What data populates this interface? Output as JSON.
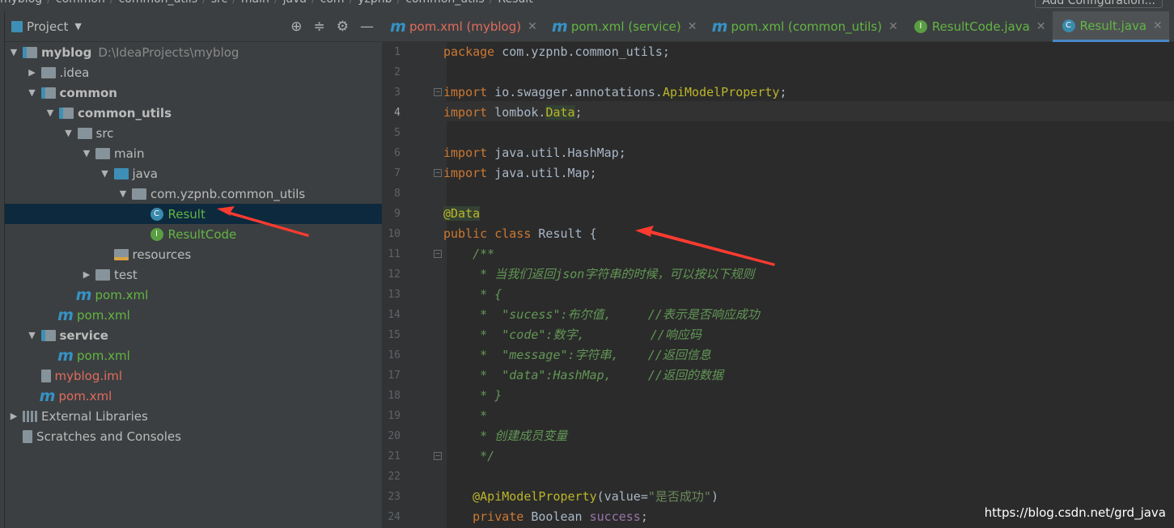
{
  "breadcrumb": [
    "myblog",
    "common",
    "common_utils",
    "src",
    "main",
    "java",
    "com",
    "yzpnb",
    "common_utils",
    "Result"
  ],
  "run_config": "Add Configuration...",
  "project_panel": {
    "title": "Project",
    "tree": [
      {
        "label": "myblog",
        "path": "D:\\IdeaProjects\\myblog",
        "depth": 0,
        "arrow": "down",
        "icon": "module-folder",
        "bold": true
      },
      {
        "label": ".idea",
        "depth": 1,
        "arrow": "right",
        "icon": "folder"
      },
      {
        "label": "common",
        "depth": 1,
        "arrow": "down",
        "icon": "module-folder",
        "bold": true
      },
      {
        "label": "common_utils",
        "depth": 2,
        "arrow": "down",
        "icon": "module-folder",
        "bold": true
      },
      {
        "label": "src",
        "depth": 3,
        "arrow": "down",
        "icon": "folder"
      },
      {
        "label": "main",
        "depth": 4,
        "arrow": "down",
        "icon": "folder"
      },
      {
        "label": "java",
        "depth": 5,
        "arrow": "down",
        "icon": "blue-folder"
      },
      {
        "label": "com.yzpnb.common_utils",
        "depth": 6,
        "arrow": "down",
        "icon": "package"
      },
      {
        "label": "Result",
        "depth": 7,
        "icon": "class",
        "color": "green",
        "selected": true
      },
      {
        "label": "ResultCode",
        "depth": 7,
        "icon": "interface",
        "color": "green"
      },
      {
        "label": "resources",
        "depth": 5,
        "icon": "resources-folder"
      },
      {
        "label": "test",
        "depth": 4,
        "arrow": "right",
        "icon": "folder"
      },
      {
        "label": "pom.xml",
        "depth": 3,
        "icon": "maven",
        "color": "green"
      },
      {
        "label": "pom.xml",
        "depth": 2,
        "icon": "maven",
        "color": "green"
      },
      {
        "label": "service",
        "depth": 1,
        "arrow": "down",
        "icon": "module-folder",
        "bold": true
      },
      {
        "label": "pom.xml",
        "depth": 2,
        "icon": "maven",
        "color": "green"
      },
      {
        "label": "myblog.iml",
        "depth": 1,
        "icon": "iml-file",
        "color": "red"
      },
      {
        "label": "pom.xml",
        "depth": 1,
        "icon": "maven",
        "color": "red"
      },
      {
        "label": "External Libraries",
        "depth": 0,
        "arrow": "right",
        "icon": "library"
      },
      {
        "label": "Scratches and Consoles",
        "depth": 0,
        "icon": "scratches"
      }
    ]
  },
  "tabs": [
    {
      "label": "pom.xml (myblog)",
      "icon": "maven",
      "color": "red"
    },
    {
      "label": "pom.xml (service)",
      "icon": "maven",
      "color": "green"
    },
    {
      "label": "pom.xml (common_utils)",
      "icon": "maven",
      "color": "green"
    },
    {
      "label": "ResultCode.java",
      "icon": "interface",
      "color": "green"
    },
    {
      "label": "Result.java",
      "icon": "class",
      "color": "green",
      "active": true
    }
  ],
  "editor": {
    "current_line": 4,
    "lines": [
      [
        [
          "kw",
          "package "
        ],
        [
          "pl",
          "com.yzpnb.common_utils;"
        ]
      ],
      [],
      [
        [
          "kw",
          "import "
        ],
        [
          "pl",
          "io.swagger.annotations."
        ],
        [
          "ann",
          "ApiModelProperty"
        ],
        [
          "pl",
          ";"
        ]
      ],
      [
        [
          "kw",
          "import "
        ],
        [
          "pl",
          "lombok."
        ],
        [
          "ann hl",
          "Data"
        ],
        [
          "pl",
          ";"
        ]
      ],
      [],
      [
        [
          "kw",
          "import "
        ],
        [
          "pl",
          "java.util.HashMap;"
        ]
      ],
      [
        [
          "kw",
          "import "
        ],
        [
          "pl",
          "java.util.Map;"
        ]
      ],
      [],
      [
        [
          "ann hl",
          "@Data"
        ]
      ],
      [
        [
          "kw",
          "public class "
        ],
        [
          "pl",
          "Result {"
        ]
      ],
      [
        [
          "doc",
          "    /**"
        ]
      ],
      [
        [
          "doc",
          "     * 当我们返回json字符串的时候，可以按以下规则"
        ]
      ],
      [
        [
          "doc",
          "     * {"
        ]
      ],
      [
        [
          "doc",
          "     *  \"sucess\":布尔值,     //表示是否响应成功"
        ]
      ],
      [
        [
          "doc",
          "     *  \"code\":数字,         //响应码"
        ]
      ],
      [
        [
          "doc",
          "     *  \"message\":字符串,    //返回信息"
        ]
      ],
      [
        [
          "doc",
          "     *  \"data\":HashMap,     //返回的数据"
        ]
      ],
      [
        [
          "doc",
          "     * }"
        ]
      ],
      [
        [
          "doc",
          "     *"
        ]
      ],
      [
        [
          "doc",
          "     * 创建成员变量"
        ]
      ],
      [
        [
          "doc",
          "     */"
        ]
      ],
      [],
      [
        [
          "ann",
          "    @ApiModelProperty"
        ],
        [
          "pl",
          "(value="
        ],
        [
          "str",
          "\"是否成功\""
        ],
        [
          "pl",
          ")"
        ]
      ],
      [
        [
          "kw",
          "    private "
        ],
        [
          "pl",
          "Boolean "
        ],
        [
          "field",
          "success"
        ],
        [
          "pl",
          ";"
        ]
      ]
    ]
  },
  "watermark": "https://blog.csdn.net/grd_java",
  "colors": {
    "accent": "#4a88c7",
    "selection": "#0d293e",
    "arrow": "#ff3b30"
  }
}
